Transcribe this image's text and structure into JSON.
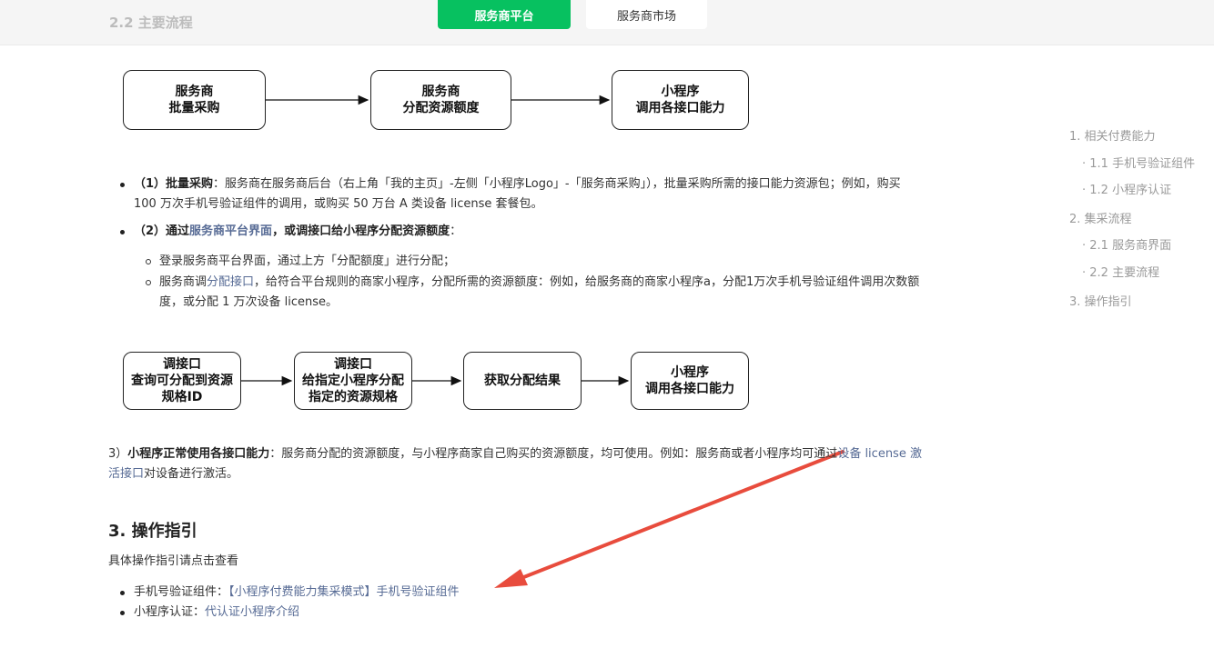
{
  "header": {
    "ghost_heading": "2.2 主要流程",
    "tab_primary": "服务商平台",
    "tab_secondary": "服务商市场"
  },
  "flow1": {
    "boxes": [
      "服务商\n批量采购",
      "服务商\n分配资源额度",
      "小程序\n调用各接口能力"
    ]
  },
  "section": {
    "item1_label": "（1）批量采购",
    "item1_text_a": "：服务商在服务商后台（右上角「我的主页」-左侧「小程序Logo」-「服务商采购」），批量采购所需的接口能力资源包；例如，购买",
    "item1_text_b": "100 万次手机号验证组件的调用，或购买 50 万台 A 类设备 license 套餐包。",
    "item2_prefix": "（2）通过",
    "item2_link": "服务商平台界面",
    "item2_suffix": "，或调接口给小程序分配资源额度",
    "item2_colon": "：",
    "sub1": "登录服务商平台界面，通过上方「分配额度」进行分配；",
    "sub2_prefix": "服务商调",
    "sub2_link": "分配接口",
    "sub2_text_a": "，给符合平台规则的商家小程序，分配所需的资源额度：例如，给服务商的商家小程序a，分配1万次手机号验证组件调用次数额",
    "sub2_text_b": "度，或分配 1 万次设备 license。"
  },
  "flow2": {
    "boxes": [
      "调接口\n查询可分配到资源\n规格ID",
      "调接口\n给指定小程序分配\n指定的资源规格",
      "获取分配结果",
      "小程序\n调用各接口能力"
    ]
  },
  "item3": {
    "prefix": "3）",
    "label": "小程序正常使用各接口能力",
    "text": "：服务商分配的资源额度，与小程序商家自己购买的资源额度，均可使用。例如：服务商或者小程序均可通过",
    "link_a": "设备 license 激",
    "link_b": "活接口",
    "text_end": "对设备进行激活。"
  },
  "ops": {
    "heading": "3. 操作指引",
    "intro": "具体操作指引请点击查看",
    "list": [
      {
        "label": "手机号验证组件：",
        "link": "【小程序付费能力集采模式】手机号验证组件"
      },
      {
        "label": "小程序认证：",
        "link": "代认证小程序介绍"
      }
    ]
  },
  "toc": {
    "items": [
      "1. 相关付费能力",
      "· 1.1 手机号验证组件",
      "· 1.2 小程序认证",
      "2. 集采流程",
      "· 2.1 服务商界面",
      "· 2.2 主要流程",
      "3. 操作指引"
    ]
  },
  "colors": {
    "accent_green": "#07c160",
    "link_blue": "#576b95",
    "annotation_red": "#e84c3d"
  }
}
